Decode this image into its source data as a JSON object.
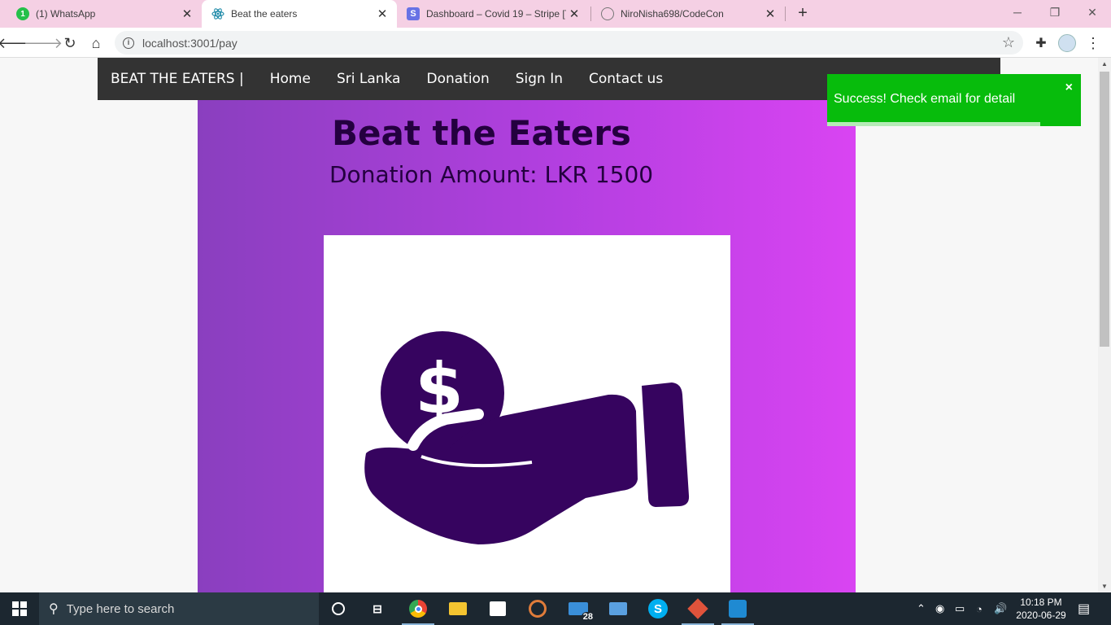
{
  "browser": {
    "tabs": [
      {
        "label": "(1) WhatsApp",
        "favicon": "whatsapp-icon"
      },
      {
        "label": "Beat the eaters",
        "favicon": "react-icon"
      },
      {
        "label": "Dashboard – Covid 19 – Stripe [Te",
        "favicon": "stripe-icon"
      },
      {
        "label": "NiroNisha698/CodeCon",
        "favicon": "github-icon"
      }
    ],
    "whatsapp_badge": "1",
    "url": "localhost:3001/pay"
  },
  "navbar": {
    "brand": "BEAT THE EATERS |",
    "links": [
      "Home",
      "Sri Lanka",
      "Donation",
      "Sign In",
      "Contact us"
    ]
  },
  "hero": {
    "title": "Beat the Eaters",
    "amount": "Donation Amount: LKR 1500",
    "image_icon": "hand-holding-dollar-icon"
  },
  "toast": {
    "message": "Success! Check email for detail",
    "close": "×",
    "progress": 0.84
  },
  "taskbar": {
    "search_placeholder": "Type here to search",
    "mail_badge": "28",
    "time": "10:18 PM",
    "date": "2020-06-29"
  },
  "colors": {
    "navbar": "#333333",
    "hero_start": "#8a3fbf",
    "hero_end": "#d944f2",
    "toast": "#07bc0c",
    "icon": "#36045f"
  }
}
